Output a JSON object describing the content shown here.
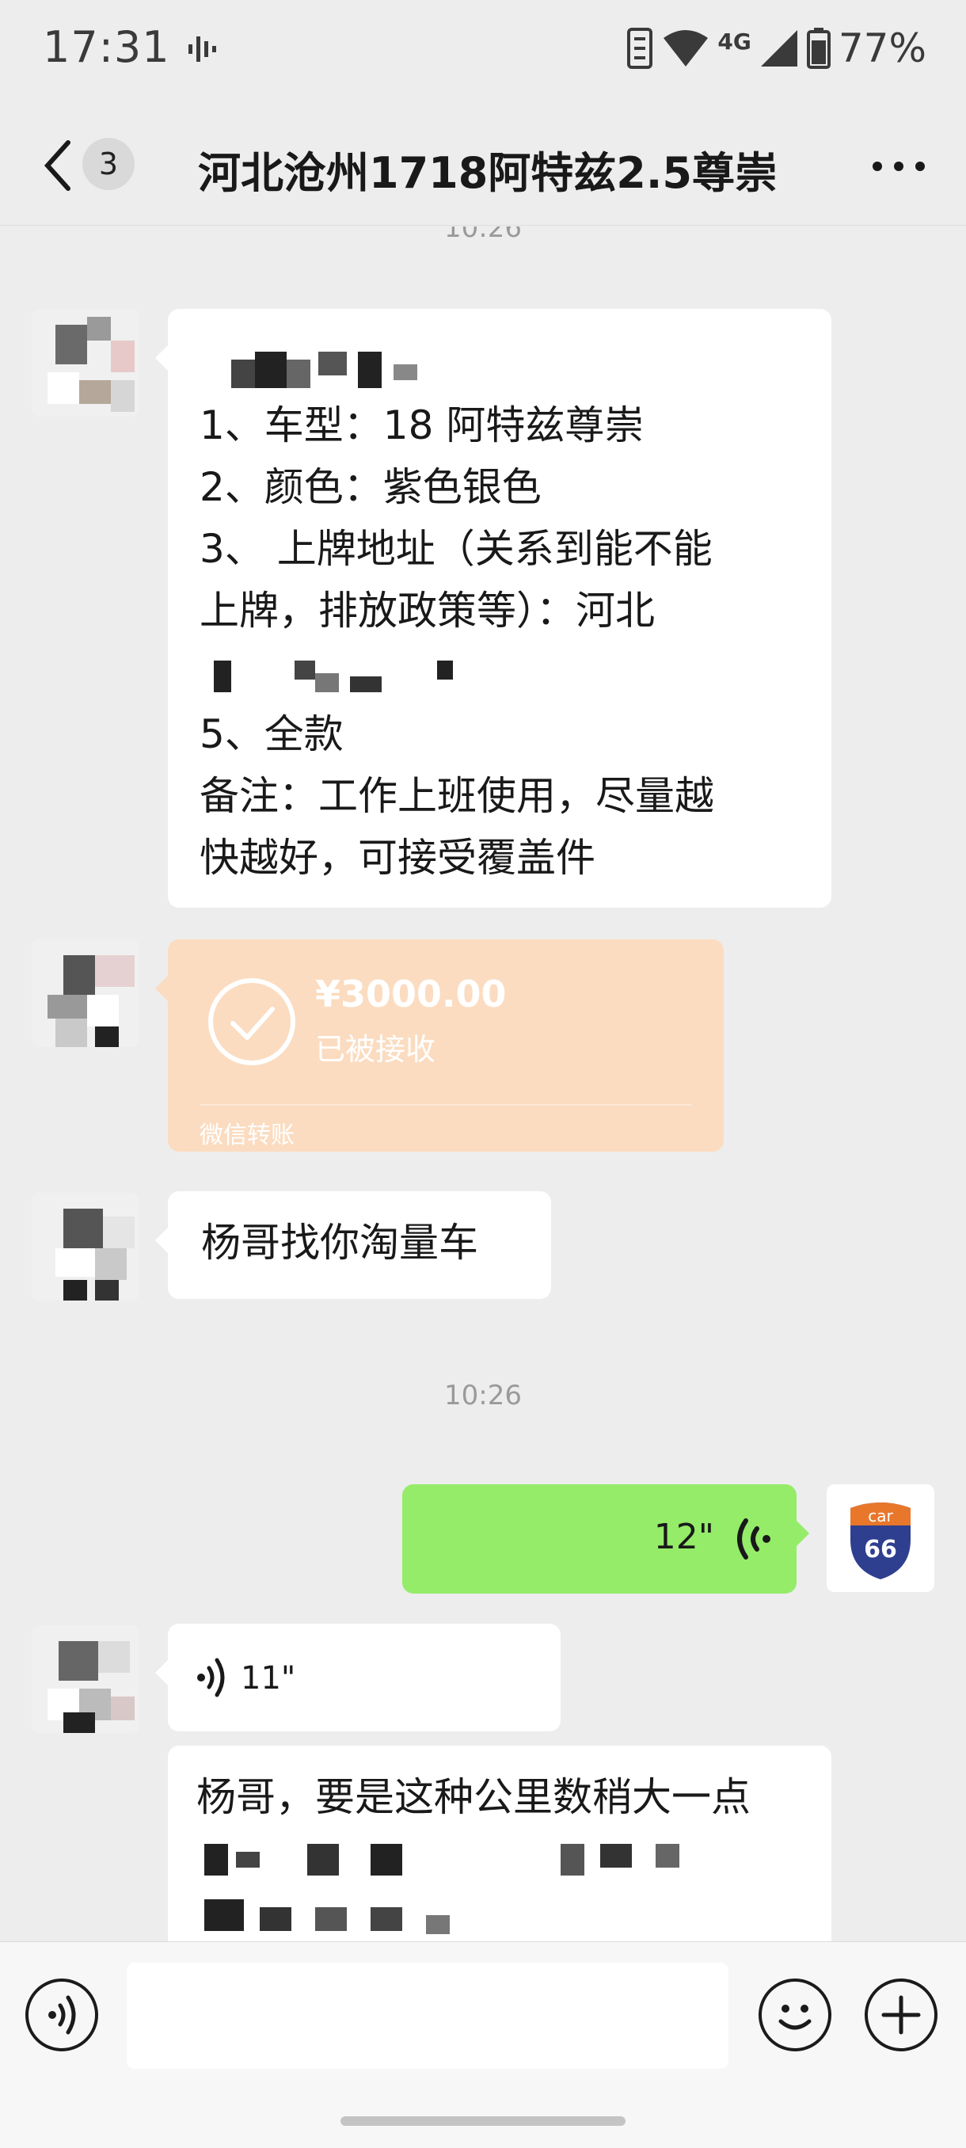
{
  "status_bar": {
    "time": "17:31",
    "network": "4G",
    "battery": "77%"
  },
  "nav": {
    "unread_count": "3",
    "title": "河北沧州1718阿特兹2.5尊崇"
  },
  "timestamps": {
    "top_cut": "10:26",
    "middle": "10:26"
  },
  "messages": {
    "order_form": {
      "lines": [
        "1、车型：18 阿特兹尊崇",
        "2、颜色：紫色银色",
        "3、 上牌地址（关系到能不能",
        "上牌，排放政策等）：河北",
        "5、全款",
        "备注：工作上班使用，尽量越",
        "快越好，可接受覆盖件"
      ]
    },
    "transfer": {
      "amount": "¥3000.00",
      "status": "已被接收",
      "source": "微信转账"
    },
    "intro": "杨哥找你淘量车",
    "voice_sent": "12\"",
    "voice_received": "11\"",
    "last_partial": "杨哥，要是这种公里数稍大一点"
  },
  "my_avatar": {
    "label_top": "car",
    "label_bottom": "66"
  }
}
